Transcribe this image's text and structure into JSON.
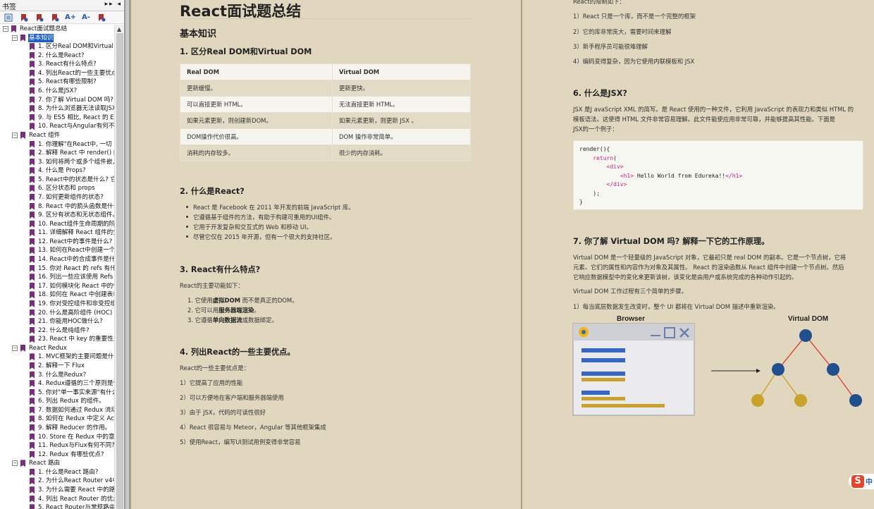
{
  "sidebar": {
    "title": "书签",
    "controls": "▸▸ ◂",
    "toolbar": [
      "",
      "",
      "",
      "",
      "A+",
      "A-",
      ""
    ],
    "tree": [
      {
        "level": 0,
        "label": "React面试题总结",
        "toggle": "−",
        "sel": false
      },
      {
        "level": 1,
        "label": "基本知识",
        "toggle": "−",
        "sel": true
      },
      {
        "level": 2,
        "label": "1. 区分Real DOM和Virtual DOM"
      },
      {
        "level": 2,
        "label": "2. 什么是React?"
      },
      {
        "level": 2,
        "label": "3. React有什么特点?"
      },
      {
        "level": 2,
        "label": "4. 列出React的一些主要优点"
      },
      {
        "level": 2,
        "label": "5. React有哪些限制?"
      },
      {
        "level": 2,
        "label": "6. 什么是JSX?"
      },
      {
        "level": 2,
        "label": "7. 你了解 Virtual DOM 吗? 解"
      },
      {
        "level": 2,
        "label": "8. 为什么浏览器无法读取JSX"
      },
      {
        "level": 2,
        "label": "9. 与 ES5 相比, React 的 ES"
      },
      {
        "level": 2,
        "label": "10. React与Angular有何不同"
      },
      {
        "level": 1,
        "label": "React 组件",
        "toggle": "−"
      },
      {
        "level": 2,
        "label": "1. 你理解\"在React中, 一切"
      },
      {
        "level": 2,
        "label": "2. 解释 React 中 render() 的"
      },
      {
        "level": 2,
        "label": "3. 如何将两个或多个组件嵌入"
      },
      {
        "level": 2,
        "label": "4. 什么是 Props?"
      },
      {
        "level": 2,
        "label": "5. React中的状态是什么? 它"
      },
      {
        "level": 2,
        "label": "6. 区分状态和 props"
      },
      {
        "level": 2,
        "label": "7. 如何更新组件的状态?"
      },
      {
        "level": 2,
        "label": "8. React 中的箭头函数是什么"
      },
      {
        "level": 2,
        "label": "9. 区分有状态和无状态组件。"
      },
      {
        "level": 2,
        "label": "10. React组件生命周期的阶段"
      },
      {
        "level": 2,
        "label": "11. 详细解释 React 组件的生"
      },
      {
        "level": 2,
        "label": "12. React中的事件是什么?"
      },
      {
        "level": 2,
        "label": "13. 如何在React中创建一个事"
      },
      {
        "level": 2,
        "label": "14. React中的合成事件是什么"
      },
      {
        "level": 2,
        "label": "15. 你对 React 的 refs 有什么"
      },
      {
        "level": 2,
        "label": "16. 列出一些应该使用 Refs 的"
      },
      {
        "level": 2,
        "label": "17. 如何模块化 React 中的代"
      },
      {
        "level": 2,
        "label": "18. 如何在 React 中创建表单"
      },
      {
        "level": 2,
        "label": "19. 你对受控组件和非受控组"
      },
      {
        "level": 2,
        "label": "20. 什么是高阶组件 (HOC)"
      },
      {
        "level": 2,
        "label": "21. 你能用HOC做什么?"
      },
      {
        "level": 2,
        "label": "22. 什么是纯组件?"
      },
      {
        "level": 2,
        "label": "23. React 中 key 的重要性是"
      },
      {
        "level": 1,
        "label": "React Redux",
        "toggle": "−"
      },
      {
        "level": 2,
        "label": "1. MVC框架的主要问题是什么"
      },
      {
        "level": 2,
        "label": "2. 解释一下 Flux"
      },
      {
        "level": 2,
        "label": "3. 什么是Redux?"
      },
      {
        "level": 2,
        "label": "4. Redux遵循的三个原则是什"
      },
      {
        "level": 2,
        "label": "5. 你对\"单一事实来源\"有什么"
      },
      {
        "level": 2,
        "label": "6. 列出 Redux 的组件。"
      },
      {
        "level": 2,
        "label": "7. 数据如何通过 Redux 流动"
      },
      {
        "level": 2,
        "label": "8. 如何在 Redux 中定义 Act"
      },
      {
        "level": 2,
        "label": "9. 解释 Reducer 的作用。"
      },
      {
        "level": 2,
        "label": "10. Store 在 Redux 中的意义"
      },
      {
        "level": 2,
        "label": "11. Redux与Flux有何不同?"
      },
      {
        "level": 2,
        "label": "12. Redux 有哪些优点?"
      },
      {
        "level": 1,
        "label": "React 路由",
        "toggle": "−"
      },
      {
        "level": 2,
        "label": "1. 什么是React 路由?"
      },
      {
        "level": 2,
        "label": "2. 为什么React Router v4中"
      },
      {
        "level": 2,
        "label": "3. 为什么需要 React 中的路由"
      },
      {
        "level": 2,
        "label": "4. 列出 React Router 的优点"
      },
      {
        "level": 2,
        "label": "5. React Router与常规路由有"
      }
    ]
  },
  "page1": {
    "title": "React面试题总结",
    "section": "基本知识",
    "q1": "1. 区分Real DOM和Virtual DOM",
    "table": {
      "headers": [
        "Real DOM",
        "Virtual DOM"
      ],
      "rows": [
        [
          "更新缓慢。",
          "更新更快。"
        ],
        [
          "可以直接更新 HTML。",
          "无法直接更新 HTML。"
        ],
        [
          "如果元素更新，则创建新DOM。",
          "如果元素更新，则更新 JSX 。"
        ],
        [
          "DOM操作代价很高。",
          "DOM 操作非常简单。"
        ],
        [
          "消耗的内存较多。",
          "很少的内存消耗。"
        ]
      ]
    },
    "q2": "2. 什么是React?",
    "q2_items": [
      "React 是 Facebook 在 2011 年开发的前端 JavaScript 库。",
      "它遵循基于组件的方法，有助于构建可重用的UI组件。",
      "它用于开发复杂和交互式的 Web 和移动 UI。",
      "尽管它仅在 2015 年开源，但有一个很大的支持社区。"
    ],
    "q3": "3. React有什么特点?",
    "q3_intro": "React的主要功能如下：",
    "q3_items": [
      {
        "pre": "1. 它使用",
        "b": "虚拟DOM",
        "post": " 而不是真正的DOM。"
      },
      {
        "pre": "2. 它可以用",
        "b": "服务器端渲染",
        "post": "。"
      },
      {
        "pre": "3. 它遵循",
        "b": "单向数据流",
        "post": "或数据绑定。"
      }
    ],
    "q4": "4. 列出React的一些主要优点。",
    "q4_intro": "React的一些主要优点是：",
    "q4_items": [
      "1）它提高了应用的性能",
      "2）可以方便地在客户端和服务器端使用",
      "3）由于 JSX，代码的可读性很好",
      "4）React 很容易与 Meteor，Angular 等其他框架集成",
      "5）使用React，编写UI测试用例变得非常容易"
    ]
  },
  "page2": {
    "intro": "React的限制如下：",
    "limits": [
      "1）React 只是一个库，而不是一个完整的框架",
      "2）它的库非常庞大，需要时间来理解",
      "3）新手程序员可能很难理解",
      "4）编码变得复杂，因为它使用内联模板和 JSX"
    ],
    "q6": "6. 什么是JSX?",
    "q6_text_1": "JSX 是J avaScript XML 的简写。是 React 使用的一种文件，它利用 JavaScript 的表现力和类似 HTML 的",
    "q6_text_2": "模板语法。这使得 HTML 文件非常容易理解。此文件能使应用非常可靠，并能够提高其性能。下面是",
    "q6_text_3": "JSX的一个例子：",
    "code": {
      "l1": "render(){",
      "l2_kw": "return",
      "l2_rest": "(",
      "l3": "<div>",
      "l4_open": "<h1>",
      "l4_text": " Hello World from Edureka!!",
      "l4_close": "</h1>",
      "l5": "</div>",
      "l6": ");",
      "l7": "}"
    },
    "q7": "7. 你了解 Virtual DOM 吗? 解释一下它的工作原理。",
    "q7_p1_1": "Virtual DOM 是一个轻量级的 JavaScript 对象，它最初只是 real DOM 的副本。它是一个节点树，它将",
    "q7_p1_2": "元素、它们的属性和内容作为对象及其属性。 React 的渲染函数从 React 组件中创建一个节点树。然后",
    "q7_p1_3": "它响应数据模型中的变化来更新该树，该变化是由用户或系统完成的各种动作引起的。",
    "q7_p2": "Virtual DOM 工作过程有三个简单的步骤。",
    "q7_p3": "1）每当底层数据发生改变时，整个 UI 都将在 Virtual DOM 描述中重新渲染。",
    "diagram": {
      "browser_label": "Browser",
      "vdom_label": "Virtual DOM"
    },
    "logo_text": "中"
  },
  "colors": {
    "node_blue": "#1f4f8f",
    "node_gold": "#c9a227",
    "edge_red": "#d9453b",
    "selection": "#1e5fc7",
    "bookmark": "#7a2d7c"
  }
}
